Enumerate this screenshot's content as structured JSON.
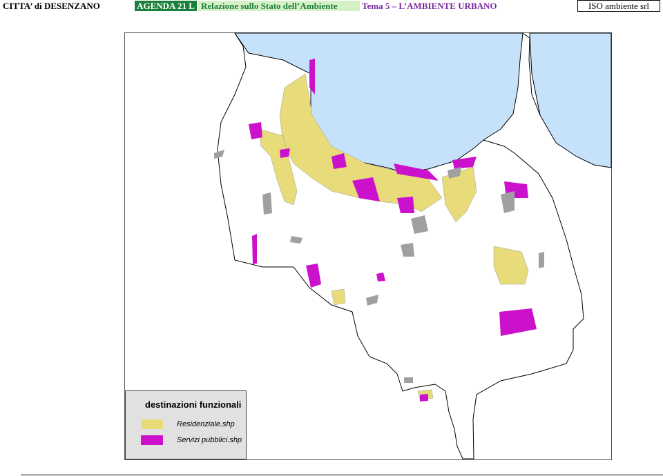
{
  "header": {
    "city": "CITTA’ di DESENZANO",
    "agenda": "AGENDA 21 L",
    "report": "Relazione sullo Stato dell’Ambiente",
    "theme": "Tema 5 – L’AMBIENTE URBANO",
    "company": "ISO ambiente srl"
  },
  "legend": {
    "title": "destinazioni funzionali",
    "items": [
      {
        "label": "Residenziale.shp",
        "color": "#e8dc7a"
      },
      {
        "label": "Servizi pubblici.shp",
        "color": "#cc11cc"
      }
    ]
  },
  "map_colors": {
    "lake": "#c6e2fa",
    "residential": "#e8dc7a",
    "public_services": "#cc11cc",
    "other_buildings": "#a0a0a0",
    "boundary": "#000000"
  }
}
